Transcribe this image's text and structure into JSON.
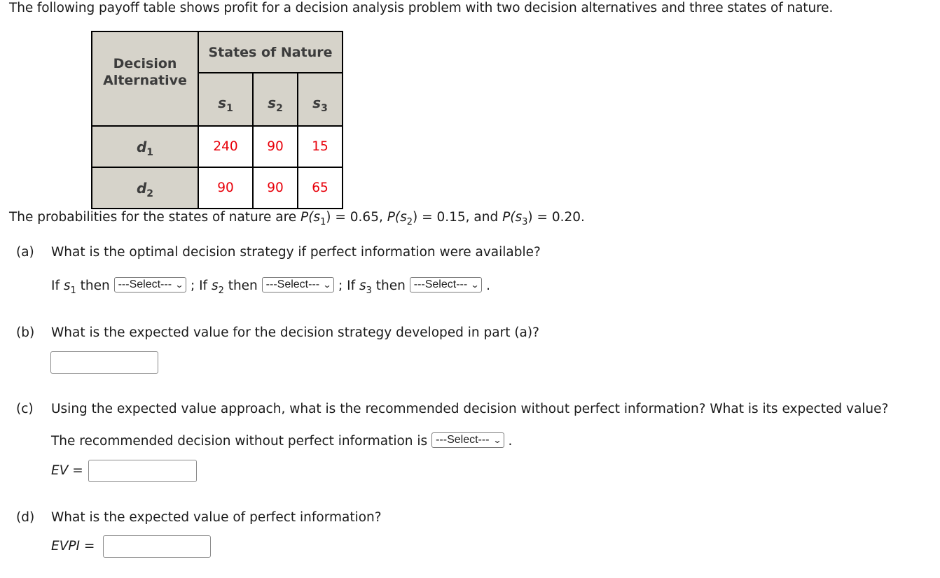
{
  "intro": "The following payoff table shows profit for a decision analysis problem with two decision alternatives and three states of nature.",
  "table": {
    "decision_header_line1": "Decision",
    "decision_header_line2": "Alternative",
    "states_header": "States of Nature",
    "states": [
      {
        "base": "s",
        "sub": "1"
      },
      {
        "base": "s",
        "sub": "2"
      },
      {
        "base": "s",
        "sub": "3"
      }
    ],
    "rows": [
      {
        "base": "d",
        "sub": "1",
        "values": [
          "240",
          "90",
          "15"
        ]
      },
      {
        "base": "d",
        "sub": "2",
        "values": [
          "90",
          "90",
          "65"
        ]
      }
    ],
    "value_color": "#e8000a",
    "header_bg": "#d6d3ca"
  },
  "probabilities": {
    "prefix": "The probabilities for the states of nature are ",
    "p1_label": "P(s",
    "p1_sub": "1",
    "p1_value": ") = 0.65, ",
    "p2_label": "P(s",
    "p2_sub": "2",
    "p2_value": ") = 0.15, and ",
    "p3_label": "P(s",
    "p3_sub": "3",
    "p3_value": ") = 0.20."
  },
  "part_a": {
    "label": "(a)",
    "question": "What is the optimal decision strategy if perfect information were available?",
    "if": "If ",
    "s": "s",
    "then": " then ",
    "sep": " ; If ",
    "end": " .",
    "selects": [
      {
        "sub": "1",
        "value": "---Select---"
      },
      {
        "sub": "2",
        "value": "---Select---"
      },
      {
        "sub": "3",
        "value": "---Select---"
      }
    ]
  },
  "part_b": {
    "label": "(b)",
    "question": "What is the expected value for the decision strategy developed in part (a)?",
    "answer": ""
  },
  "part_c": {
    "label": "(c)",
    "question": "Using the expected value approach, what is the recommended decision without perfect information? What is its expected value?",
    "recommend_text": "The recommended decision without perfect information is ",
    "select_value": "---Select---",
    "end": " .",
    "ev_label": "EV",
    "equals": " =",
    "ev_answer": ""
  },
  "part_d": {
    "label": "(d)",
    "question": "What is the expected value of perfect information?",
    "evpi_label": "EVPI",
    "equals": " =",
    "evpi_answer": ""
  },
  "icons": {
    "dropdown": "chevron-down-icon"
  }
}
